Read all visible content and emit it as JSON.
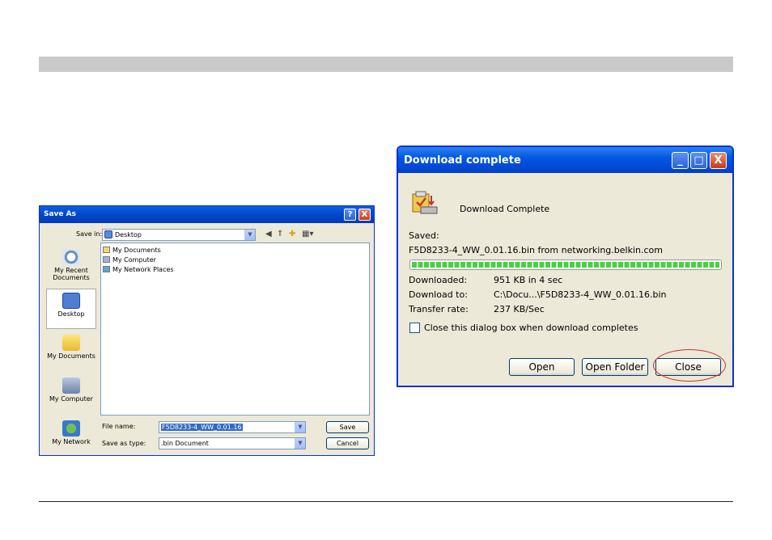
{
  "save_dialog": {
    "title": "Save As",
    "save_in_label": "Save in:",
    "save_in_value": "Desktop",
    "places": [
      "My Recent Documents",
      "Desktop",
      "My Documents",
      "My Computer",
      "My Network"
    ],
    "files": [
      "My Documents",
      "My Computer",
      "My Network Places"
    ],
    "file_name_label": "File name:",
    "file_name_value": "F5D8233-4_WW_0.01.16",
    "save_type_label": "Save as type:",
    "save_type_value": ".bin Document",
    "save_button": "Save",
    "cancel_button": "Cancel",
    "help_glyph": "?",
    "close_glyph": "X"
  },
  "download_dialog": {
    "title": "Download complete",
    "heading": "Download Complete",
    "saved_label": "Saved:",
    "saved_path": "F5D8233-4_WW_0.01.16.bin from networking.belkin.com",
    "progress_percent": 100,
    "rows": [
      {
        "label": "Downloaded:",
        "value": "951 KB in 4 sec"
      },
      {
        "label": "Download to:",
        "value": "C:\\Docu...\\F5D8233-4_WW_0.01.16.bin"
      },
      {
        "label": "Transfer rate:",
        "value": "237 KB/Sec"
      }
    ],
    "checkbox_label": "Close this dialog box when download completes",
    "checkbox_checked": false,
    "buttons": {
      "open": "Open",
      "open_folder": "Open Folder",
      "close": "Close"
    },
    "minimize_glyph": "_",
    "maximize_glyph": "□",
    "close_glyph": "X"
  }
}
